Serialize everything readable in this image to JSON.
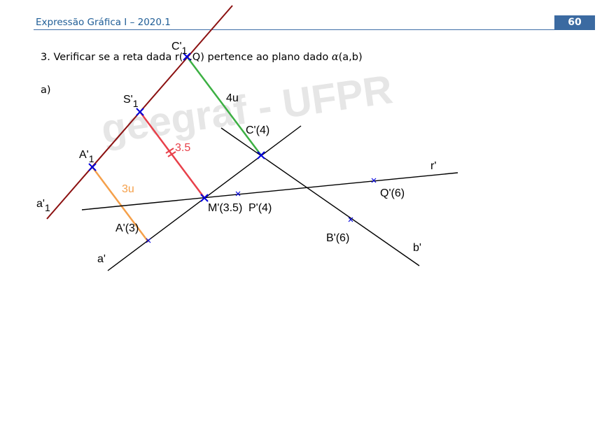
{
  "header": {
    "title": "Expressão Gráfica I – 2020.1",
    "page_number": "60"
  },
  "question": {
    "prefix": "3. Verificar se a reta dada r(",
    "hidden": "P",
    "middle": ",Q) pertence ao plano dado ",
    "alpha": "α",
    "suffix": "(a,b)"
  },
  "item_label": "a)",
  "watermark": "geegraf - UFPR",
  "colors": {
    "header_text": "#1f5d96",
    "badge": "#3b6aa1",
    "trace_line": "#8b1010",
    "green_segment": "#3cb043",
    "red_segment": "#e8404a",
    "orange_segment": "#f5a04a",
    "marker": "#0000dd"
  },
  "labels": {
    "a1": "a'",
    "a1_sub": "1",
    "c1": "C'",
    "c1_sub": "1",
    "s1": "S'",
    "s1_sub": "1",
    "A1": "A'",
    "A1_sub": "1",
    "c4": "C'(4)",
    "four_u": "4u",
    "three_five": "3.5",
    "three_u": "3u",
    "r": "r'",
    "q6": "Q'(6)",
    "m35": "M'(3.5)",
    "p4": "P'(4)",
    "a3": "A'(3)",
    "a": "a'",
    "b6": "B'(6)",
    "b": "b'"
  }
}
